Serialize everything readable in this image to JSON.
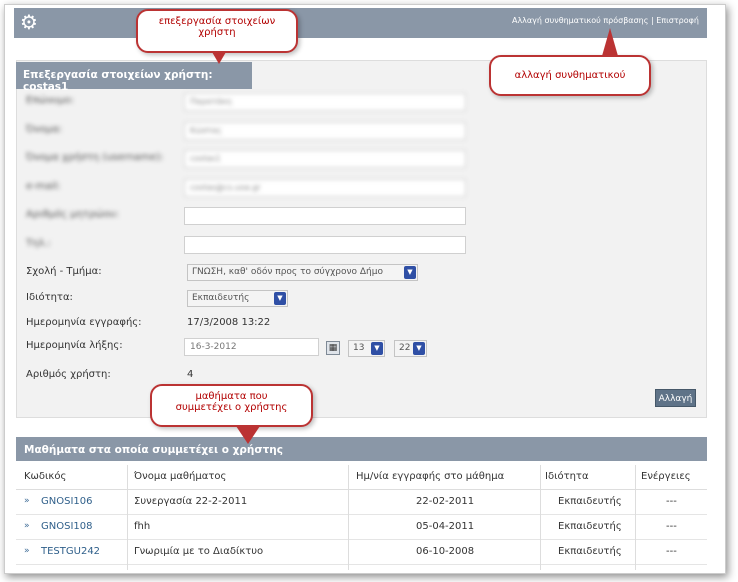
{
  "top": {
    "change_password": "Αλλαγή συνθηματικού πρόσβασης",
    "separator": "|",
    "return": "Επιστροφή"
  },
  "callouts": {
    "edit_user": "επεξεργασία στοιχείων χρήστη",
    "change_password": "αλλαγή συνθηματικού",
    "courses": "μαθήματα που συμμετέχει ο χρήστης"
  },
  "panel": {
    "title": "Επεξεργασία στοιχείων χρήστη: costas1",
    "fields": [
      {
        "label": "Επώνυμο:",
        "value": "Παρατάκη"
      },
      {
        "label": "Όνομα:",
        "value": "Κώστας"
      },
      {
        "label": "Όνομα χρήστη (username):",
        "value": "costas1"
      },
      {
        "label": "e-mail:",
        "value": "costas@cs.uoa.gr"
      },
      {
        "label": "Αριθμός μητρώου:",
        "value": ""
      },
      {
        "label": "Τηλ.:",
        "value": ""
      }
    ],
    "faculty_label": "Σχολή - Τμήμα:",
    "faculty_value": "ΓΝΩΣΗ, καθ' οδόν προς το σύγχρονο Δήμο",
    "role_label": "Ιδιότητα:",
    "role_value": "Εκπαιδευτής",
    "reg_date_label": "Ημερομηνία εγγραφής:",
    "reg_date_value": "17/3/2008 13:22",
    "exp_date_label": "Ημερομηνία λήξης:",
    "exp_date_value": "16-3-2012",
    "exp_hour": "13",
    "exp_minute": "22",
    "calendar_icon": "calendar-icon",
    "user_id_label": "Αριθμός χρήστη:",
    "user_id_value": "4",
    "submit_label": "Αλλαγή"
  },
  "courses": {
    "title": "Μαθήματα στα οποία συμμετέχει ο χρήστης",
    "headers": [
      "Κωδικός",
      "Όνομα μαθήματος",
      "Ημ/νία εγγραφής στο μάθημα",
      "Ιδιότητα",
      "Ενέργειες"
    ],
    "rows": [
      {
        "code": "GNOSI106",
        "name": "Συνεργασία 22-2-2011",
        "date": "22-02-2011",
        "role": "Εκπαιδευτής",
        "actions": "---"
      },
      {
        "code": "GNOSI108",
        "name": "fhh",
        "date": "05-04-2011",
        "role": "Εκπαιδευτής",
        "actions": "---"
      },
      {
        "code": "TESTGU242",
        "name": "Γνωριμία με το Διαδίκτυο",
        "date": "06-10-2008",
        "role": "Εκπαιδευτής",
        "actions": "---"
      }
    ],
    "row_marker": "»"
  },
  "colors": {
    "bar": "#8a97a7",
    "callout_border": "#b33333",
    "link": "#2f5f8a"
  }
}
